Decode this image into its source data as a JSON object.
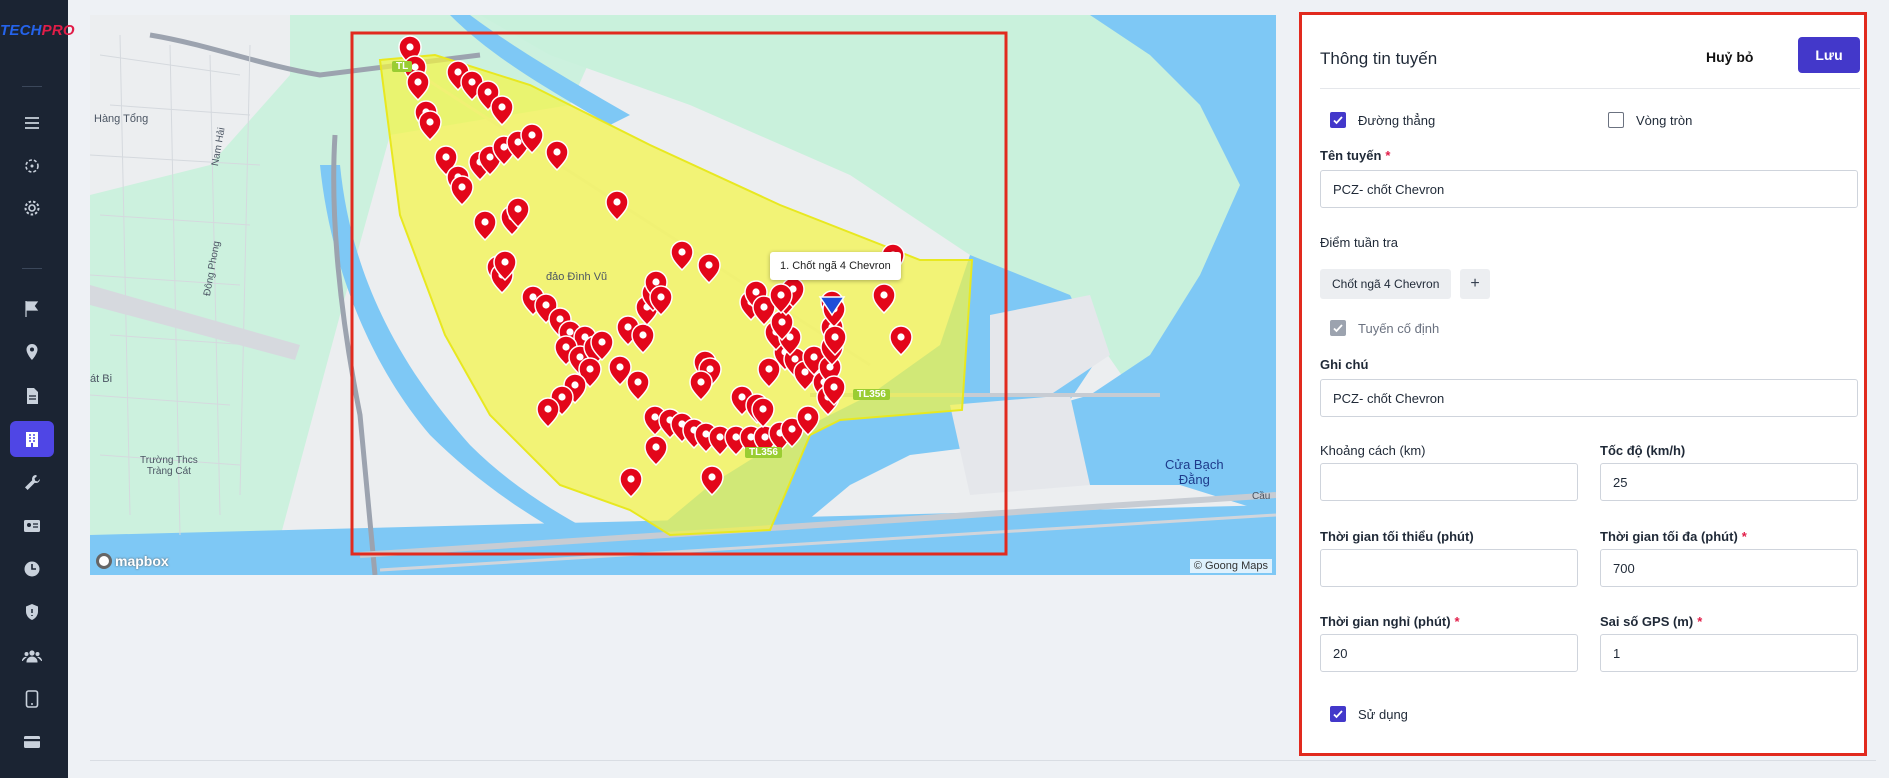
{
  "brand": {
    "part1": "TECH",
    "part2": "PRO"
  },
  "sidebar": {
    "items": [
      {
        "icon": "menu-icon"
      },
      {
        "icon": "crosshair-icon"
      },
      {
        "icon": "gear-icon"
      },
      {
        "icon": "flag-icon"
      },
      {
        "icon": "location-pin-icon"
      },
      {
        "icon": "document-icon"
      },
      {
        "icon": "building-icon",
        "active": true
      },
      {
        "icon": "wrench-icon"
      },
      {
        "icon": "id-card-icon"
      },
      {
        "icon": "clock-icon"
      },
      {
        "icon": "shield-icon"
      },
      {
        "icon": "users-icon"
      },
      {
        "icon": "tablet-icon"
      },
      {
        "icon": "credit-card-icon"
      }
    ]
  },
  "map": {
    "callout": "1. Chốt ngã 4 Chevron",
    "attribution": "© Goong Maps",
    "logo": "mapbox",
    "labels": {
      "hang_tong": "Hàng Tổng",
      "dao_dinh_vu": "đảo Đình Vũ",
      "at_bi": "át Bi",
      "school": "Trường Thcs\nTràng Cát",
      "cua_bach_dang": "Cửa Bạch\nĐằng",
      "cau": "Cầu",
      "nam_hai": "Nam Hải",
      "dong_phong": "Đông Phong",
      "road_tl356": "TL356",
      "road_tl": "TL"
    },
    "colors": {
      "water": "#7ec8f5",
      "park": "#c9f1dc",
      "zone_fill": "#f5f542",
      "zone_stroke": "#e8e820",
      "marker": "#e3061a",
      "selected_marker": "#1d4ed8",
      "frame": "#e12a1e"
    }
  },
  "form": {
    "title": "Thông tin tuyến",
    "cancel_label": "Huỷ bỏ",
    "save_label": "Lưu",
    "straight_line_label": "Đường thẳng",
    "circle_label": "Vòng tròn",
    "route_name_label": "Tên tuyến",
    "route_name_value": "PCZ- chốt Chevron",
    "patrol_points_label": "Điểm tuần tra",
    "patrol_point_chip": "Chốt ngã 4 Chevron",
    "add_point": "+",
    "fixed_route_label": "Tuyến cố định",
    "note_label": "Ghi chú",
    "note_value": "PCZ- chốt Chevron",
    "distance_label": "Khoảng cách (km)",
    "distance_value": "",
    "speed_label": "Tốc độ (km/h)",
    "speed_value": "25",
    "min_time_label": "Thời gian tối thiểu (phút)",
    "min_time_value": "",
    "max_time_label": "Thời gian tối đa (phút)",
    "max_time_value": "700",
    "rest_time_label": "Thời gian nghỉ (phút)",
    "rest_time_value": "20",
    "gps_error_label": "Sai số GPS (m)",
    "gps_error_value": "1",
    "in_use_label": "Sử dụng",
    "required_mark": "*",
    "accent": "#4338ca"
  }
}
